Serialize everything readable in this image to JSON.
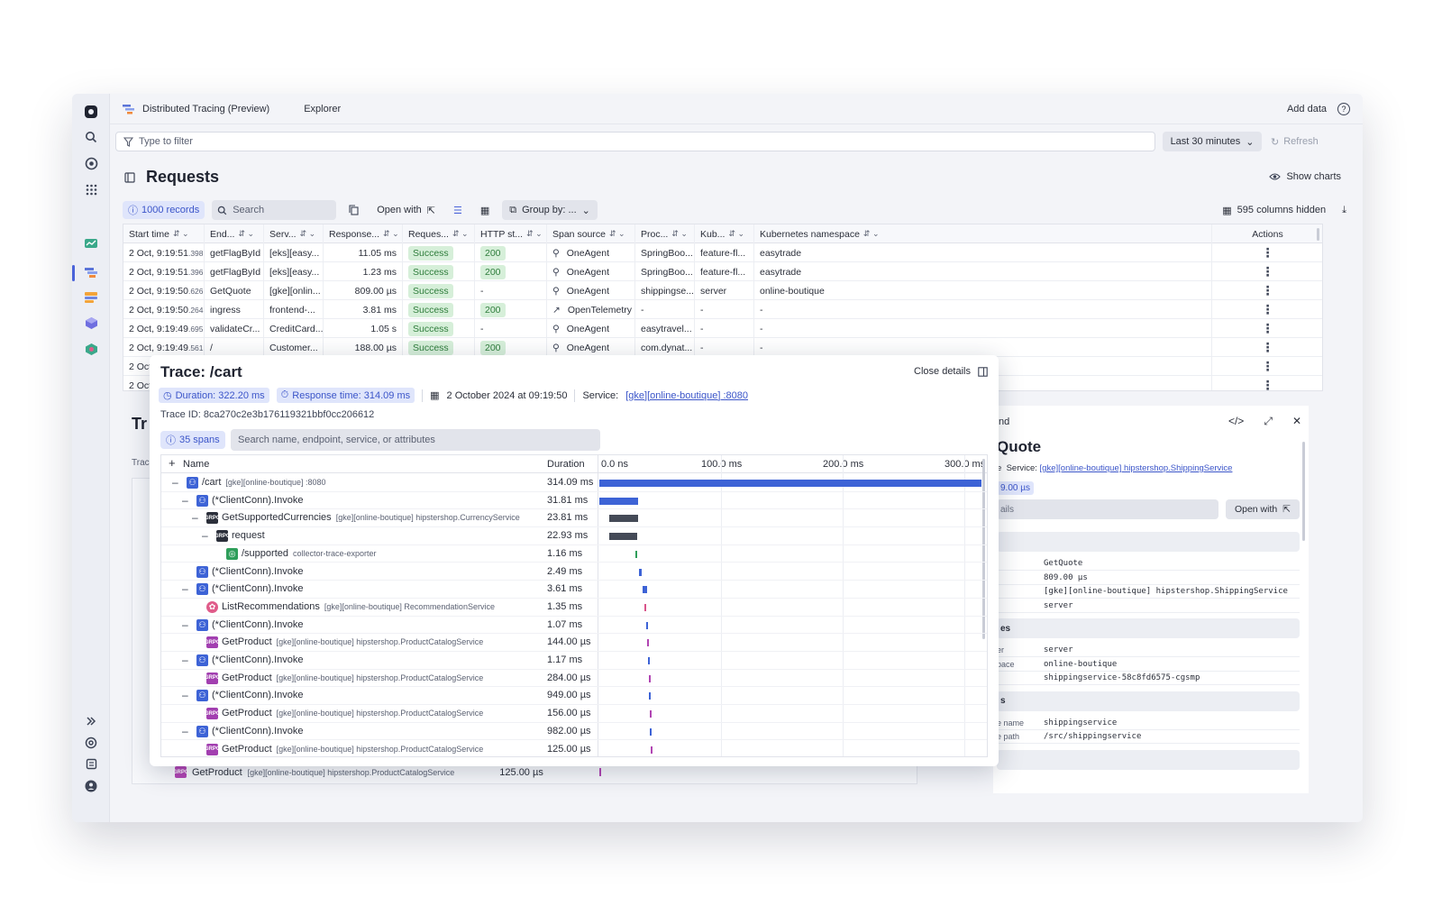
{
  "app": {
    "name": "Distributed Tracing (Preview)",
    "tab": "Explorer",
    "add_data": "Add data",
    "help": "?"
  },
  "filter": {
    "placeholder": "Type to filter",
    "timeframe": "Last 30 minutes",
    "refresh": "Refresh"
  },
  "requests": {
    "title": "Requests",
    "show_charts": "Show charts",
    "records": "1000 records",
    "search_placeholder": "Search",
    "open_with": "Open with",
    "group_by": "Group by: ...",
    "columns_hidden": "595 columns hidden",
    "columns": [
      "Start time",
      "End...",
      "Serv...",
      "Response...",
      "Reques...",
      "HTTP st...",
      "Span source",
      "Proc...",
      "Kub...",
      "Kubernetes namespace",
      "Actions"
    ],
    "rows": [
      {
        "start": "2 Oct, 9:19:51",
        "ms": ".398",
        "end": "getFlagById",
        "svc": "[eks][easy...",
        "resp": "11.05 ms",
        "req": "Success",
        "http": "200",
        "src": "OneAgent",
        "proc": "SpringBoo...",
        "kub": "feature-fl...",
        "ns": "easytrade"
      },
      {
        "start": "2 Oct, 9:19:51",
        "ms": ".396",
        "end": "getFlagById",
        "svc": "[eks][easy...",
        "resp": "1.23 ms",
        "req": "Success",
        "http": "200",
        "src": "OneAgent",
        "proc": "SpringBoo...",
        "kub": "feature-fl...",
        "ns": "easytrade"
      },
      {
        "start": "2 Oct, 9:19:50",
        "ms": ".626",
        "end": "GetQuote",
        "svc": "[gke][onlin...",
        "resp": "809.00 µs",
        "req": "Success",
        "http": "-",
        "src": "OneAgent",
        "proc": "shippingse...",
        "kub": "server",
        "ns": "online-boutique"
      },
      {
        "start": "2 Oct, 9:19:50",
        "ms": ".264",
        "end": "ingress",
        "svc": "frontend-...",
        "resp": "3.81 ms",
        "req": "Success",
        "http": "200",
        "src": "OpenTelemetry",
        "proc": "-",
        "kub": "-",
        "ns": "-"
      },
      {
        "start": "2 Oct, 9:19:49",
        "ms": ".695",
        "end": "validateCr...",
        "svc": "CreditCard...",
        "resp": "1.05 s",
        "req": "Success",
        "http": "-",
        "src": "OneAgent",
        "proc": "easytravel...",
        "kub": "-",
        "ns": "-"
      },
      {
        "start": "2 Oct, 9:19:49",
        "ms": ".561",
        "end": "/",
        "svc": "Customer...",
        "resp": "188.00 µs",
        "req": "Success",
        "http": "200",
        "src": "OneAgent",
        "proc": "com.dynat...",
        "kub": "-",
        "ns": "-"
      },
      {
        "start": "2 Oct",
        "ms": "",
        "end": "",
        "svc": "",
        "resp": "",
        "req": "",
        "http": "",
        "src": "",
        "proc": "",
        "kub": "",
        "ns": ""
      },
      {
        "start": "2 Oct",
        "ms": "",
        "end": "",
        "svc": "",
        "resp": "",
        "req": "",
        "http": "",
        "src": "",
        "proc": "",
        "kub": "",
        "ns": ""
      }
    ]
  },
  "background_trace": {
    "title": "Tr",
    "label": "Trac"
  },
  "detail": {
    "title": "Trace: /cart",
    "close": "Close details",
    "duration": "Duration: 322.20 ms",
    "response_time": "Response time: 314.09 ms",
    "date": "2 October 2024 at 09:19:50",
    "service_label": "Service:",
    "service": "[gke][online-boutique] :8080",
    "trace_id": "Trace ID: 8ca270c2e3b176119321bbf0cc206612",
    "spans": "35 spans",
    "search_placeholder": "Search name, endpoint, service, or attributes",
    "col_name": "Name",
    "col_duration": "Duration",
    "ticks": [
      "0.0 ns",
      "100.0 ms",
      "200.0 ms",
      "300.0 ms"
    ],
    "rows": [
      {
        "depth": 0,
        "toggle": "–",
        "kind": "http",
        "name": "/cart",
        "sub": "[gke][online-boutique] :8080",
        "dur": "314.09 ms",
        "start": 0.0,
        "len": 1.0,
        "color": "#3d63d6"
      },
      {
        "depth": 1,
        "toggle": "–",
        "kind": "http",
        "name": "(*ClientConn).Invoke",
        "sub": "",
        "dur": "31.81 ms",
        "start": 0.0,
        "len": 0.101,
        "color": "#3d63d6"
      },
      {
        "depth": 2,
        "toggle": "–",
        "kind": "grpc-dark",
        "name": "GetSupportedCurrencies",
        "sub": "[gke][online-boutique] hipstershop.CurrencyService",
        "dur": "23.81 ms",
        "start": 0.026,
        "len": 0.076,
        "color": "#444a57"
      },
      {
        "depth": 3,
        "toggle": "–",
        "kind": "grpc-dark",
        "name": "request",
        "sub": "",
        "dur": "22.93 ms",
        "start": 0.027,
        "len": 0.073,
        "color": "#444a57"
      },
      {
        "depth": 4,
        "toggle": "",
        "kind": "green",
        "name": "/supported",
        "sub": "collector-trace-exporter",
        "dur": "1.16 ms",
        "start": 0.094,
        "len": 0.004,
        "color": "#2e9e5a"
      },
      {
        "depth": 1,
        "toggle": "",
        "kind": "http",
        "name": "(*ClientConn).Invoke",
        "sub": "",
        "dur": "2.49 ms",
        "start": 0.104,
        "len": 0.008,
        "color": "#3d63d6"
      },
      {
        "depth": 1,
        "toggle": "–",
        "kind": "http",
        "name": "(*ClientConn).Invoke",
        "sub": "",
        "dur": "3.61 ms",
        "start": 0.113,
        "len": 0.011,
        "color": "#3d63d6"
      },
      {
        "depth": 2,
        "toggle": "",
        "kind": "pink",
        "name": "ListRecommendations",
        "sub": "[gke][online-boutique] RecommendationService",
        "dur": "1.35 ms",
        "start": 0.118,
        "len": 0.004,
        "color": "#d9548a"
      },
      {
        "depth": 1,
        "toggle": "–",
        "kind": "http",
        "name": "(*ClientConn).Invoke",
        "sub": "",
        "dur": "1.07 ms",
        "start": 0.122,
        "len": 0.004,
        "color": "#3d63d6"
      },
      {
        "depth": 2,
        "toggle": "",
        "kind": "purple",
        "name": "GetProduct",
        "sub": "[gke][online-boutique] hipstershop.ProductCatalogService",
        "dur": "144.00 µs",
        "start": 0.125,
        "len": 0.002,
        "color": "#b145b3"
      },
      {
        "depth": 1,
        "toggle": "–",
        "kind": "http",
        "name": "(*ClientConn).Invoke",
        "sub": "",
        "dur": "1.17 ms",
        "start": 0.127,
        "len": 0.004,
        "color": "#3d63d6"
      },
      {
        "depth": 2,
        "toggle": "",
        "kind": "purple",
        "name": "GetProduct",
        "sub": "[gke][online-boutique] hipstershop.ProductCatalogService",
        "dur": "284.00 µs",
        "start": 0.129,
        "len": 0.002,
        "color": "#b145b3"
      },
      {
        "depth": 1,
        "toggle": "–",
        "kind": "http",
        "name": "(*ClientConn).Invoke",
        "sub": "",
        "dur": "949.00 µs",
        "start": 0.129,
        "len": 0.003,
        "color": "#3d63d6"
      },
      {
        "depth": 2,
        "toggle": "",
        "kind": "purple",
        "name": "GetProduct",
        "sub": "[gke][online-boutique] hipstershop.ProductCatalogService",
        "dur": "156.00 µs",
        "start": 0.132,
        "len": 0.002,
        "color": "#b145b3"
      },
      {
        "depth": 1,
        "toggle": "–",
        "kind": "http",
        "name": "(*ClientConn).Invoke",
        "sub": "",
        "dur": "982.00 µs",
        "start": 0.132,
        "len": 0.003,
        "color": "#3d63d6"
      },
      {
        "depth": 2,
        "toggle": "",
        "kind": "purple",
        "name": "GetProduct",
        "sub": "[gke][online-boutique] hipstershop.ProductCatalogService",
        "dur": "125.00 µs",
        "start": 0.135,
        "len": 0.002,
        "color": "#b145b3"
      }
    ]
  },
  "bg_last_row": {
    "name": "GetProduct",
    "sub": "[gke][online-boutique] hipstershop.ProductCatalogService",
    "dur": "125.00 µs"
  },
  "side_panel": {
    "header": "nd",
    "title": "Quote",
    "service_prefix": "e",
    "service_label": "Service:",
    "service": "[gke][online-boutique] hipstershop.ShippingService",
    "pill": "9.00 µs",
    "input": "ails",
    "open_with": "Open with",
    "sections": [
      "",
      "es",
      "s",
      ""
    ],
    "kv1": [
      {
        "k": "",
        "v": "GetQuote"
      },
      {
        "k": "",
        "v": "809.00 µs"
      },
      {
        "k": "",
        "v": "[gke][online-boutique] hipstershop.ShippingService"
      },
      {
        "k": "",
        "v": "server"
      }
    ],
    "kv2": [
      {
        "k": "er",
        "v": "server"
      },
      {
        "k": "pace",
        "v": "online-boutique"
      },
      {
        "k": "",
        "v": "shippingservice-58c8fd6575-cgsmp"
      }
    ],
    "kv3": [
      {
        "k": "e name",
        "v": "shippingservice"
      },
      {
        "k": "e path",
        "v": "/src/shippingservice"
      }
    ]
  },
  "icons": {
    "grpc": "GRPC"
  },
  "colors": {
    "accent": "#4a63d9",
    "success_bg": "#d6efd9",
    "success_fg": "#2f7d3c"
  }
}
